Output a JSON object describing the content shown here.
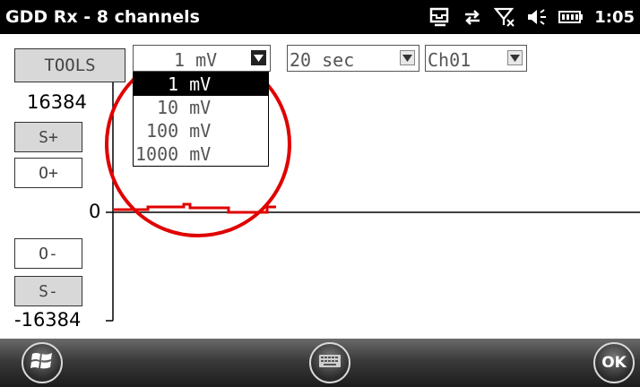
{
  "titlebar": {
    "title": "GDD Rx - 8 channels",
    "time": "1:05",
    "icons": [
      "inbox-icon",
      "connection-icon",
      "no-signal-icon",
      "volume-icon",
      "battery-icon"
    ]
  },
  "toolbar": {
    "tools_label": "TOOLS",
    "range_value": "1 mV",
    "time_value": "20 sec",
    "channel_value": "Ch01"
  },
  "range_dropdown": {
    "options": [
      "1 mV",
      "10 mV",
      "100 mV",
      "1000 mV"
    ],
    "selected": "1 mV"
  },
  "side_buttons": {
    "s_plus": "S+",
    "o_plus": "O+",
    "o_minus": "O-",
    "s_minus": "S-"
  },
  "axis": {
    "top": "16384",
    "zero": "0",
    "bottom": "-16384"
  },
  "softkeys": {
    "ok_label": "OK",
    "start_icon": "windows-start-icon",
    "keyboard_icon": "keyboard-icon"
  },
  "colors": {
    "trace": "#e00000",
    "highlight_circle": "#e00000"
  }
}
